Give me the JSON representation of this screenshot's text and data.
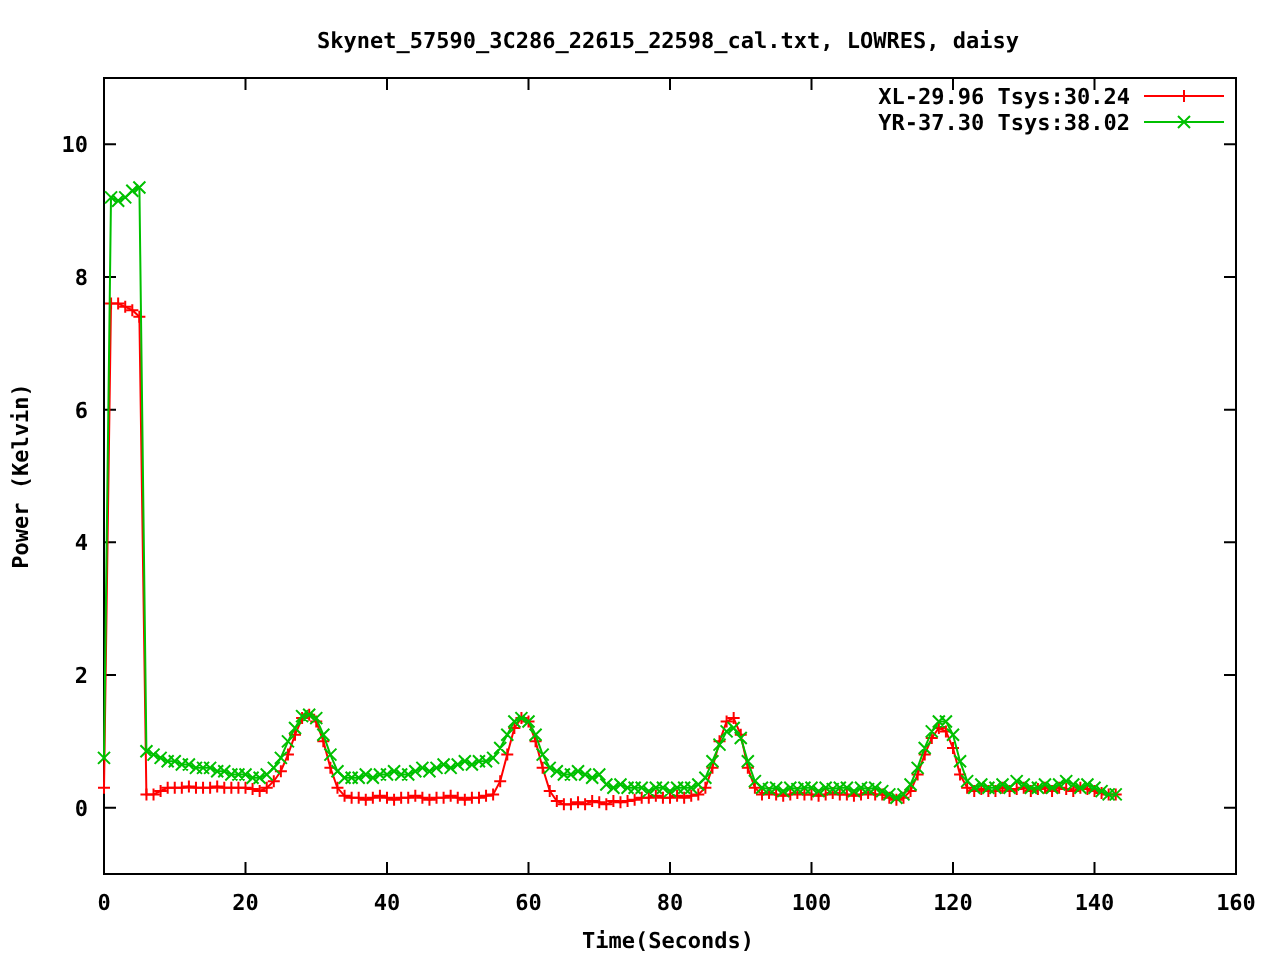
{
  "chart_data": {
    "type": "line",
    "title": "Skynet_57590_3C286_22615_22598_cal.txt, LOWRES, daisy",
    "xlabel": "Time(Seconds)",
    "ylabel": "Power (Kelvin)",
    "xlim": [
      0,
      160
    ],
    "ylim": [
      -1,
      11
    ],
    "xticks": [
      0,
      20,
      40,
      60,
      80,
      100,
      120,
      140,
      160
    ],
    "yticks": [
      0,
      2,
      4,
      6,
      8,
      10
    ],
    "legend": true,
    "x": [
      0,
      1,
      2,
      3,
      4,
      5,
      6,
      7,
      8,
      9,
      10,
      11,
      12,
      13,
      14,
      15,
      16,
      17,
      18,
      19,
      20,
      21,
      22,
      23,
      24,
      25,
      26,
      27,
      28,
      29,
      30,
      31,
      32,
      33,
      34,
      35,
      36,
      37,
      38,
      39,
      40,
      41,
      42,
      43,
      44,
      45,
      46,
      47,
      48,
      49,
      50,
      51,
      52,
      53,
      54,
      55,
      56,
      57,
      58,
      59,
      60,
      61,
      62,
      63,
      64,
      65,
      66,
      67,
      68,
      69,
      70,
      71,
      72,
      73,
      74,
      75,
      76,
      77,
      78,
      79,
      80,
      81,
      82,
      83,
      84,
      85,
      86,
      87,
      88,
      89,
      90,
      91,
      92,
      93,
      94,
      95,
      96,
      97,
      98,
      99,
      100,
      101,
      102,
      103,
      104,
      105,
      106,
      107,
      108,
      109,
      110,
      111,
      112,
      113,
      114,
      115,
      116,
      117,
      118,
      119,
      120,
      121,
      122,
      123,
      124,
      125,
      126,
      127,
      128,
      129,
      130,
      131,
      132,
      133,
      134,
      135,
      136,
      137,
      138,
      139,
      140,
      141,
      142,
      143
    ],
    "series": [
      {
        "name": "XL-29.96 Tsys:30.24",
        "color": "#ff0000",
        "marker": "plus",
        "values": [
          0.3,
          7.6,
          7.6,
          7.55,
          7.5,
          7.4,
          0.2,
          0.2,
          0.25,
          0.3,
          0.3,
          0.3,
          0.32,
          0.3,
          0.3,
          0.3,
          0.32,
          0.3,
          0.3,
          0.3,
          0.3,
          0.28,
          0.25,
          0.3,
          0.4,
          0.55,
          0.8,
          1.1,
          1.35,
          1.4,
          1.3,
          1.0,
          0.6,
          0.3,
          0.18,
          0.15,
          0.15,
          0.12,
          0.15,
          0.18,
          0.15,
          0.12,
          0.15,
          0.15,
          0.18,
          0.15,
          0.12,
          0.15,
          0.15,
          0.18,
          0.15,
          0.12,
          0.15,
          0.15,
          0.18,
          0.2,
          0.4,
          0.8,
          1.2,
          1.35,
          1.3,
          1.0,
          0.6,
          0.25,
          0.1,
          0.05,
          0.05,
          0.08,
          0.05,
          0.1,
          0.08,
          0.05,
          0.1,
          0.08,
          0.1,
          0.12,
          0.15,
          0.15,
          0.18,
          0.15,
          0.15,
          0.18,
          0.15,
          0.18,
          0.2,
          0.3,
          0.6,
          1.0,
          1.3,
          1.35,
          1.1,
          0.6,
          0.3,
          0.2,
          0.22,
          0.2,
          0.18,
          0.2,
          0.22,
          0.2,
          0.2,
          0.18,
          0.2,
          0.22,
          0.2,
          0.2,
          0.18,
          0.2,
          0.22,
          0.2,
          0.2,
          0.15,
          0.12,
          0.15,
          0.25,
          0.5,
          0.8,
          1.05,
          1.2,
          1.15,
          0.9,
          0.5,
          0.3,
          0.25,
          0.28,
          0.25,
          0.25,
          0.3,
          0.25,
          0.28,
          0.3,
          0.25,
          0.28,
          0.3,
          0.25,
          0.3,
          0.28,
          0.25,
          0.3,
          0.28,
          0.25,
          0.22,
          0.2,
          0.2
        ]
      },
      {
        "name": "YR-37.30 Tsys:38.02",
        "color": "#00c000",
        "marker": "cross",
        "values": [
          0.75,
          9.2,
          9.15,
          9.2,
          9.3,
          9.35,
          0.85,
          0.8,
          0.75,
          0.7,
          0.7,
          0.65,
          0.65,
          0.6,
          0.6,
          0.6,
          0.55,
          0.55,
          0.5,
          0.5,
          0.5,
          0.45,
          0.45,
          0.5,
          0.6,
          0.75,
          1.0,
          1.2,
          1.38,
          1.4,
          1.35,
          1.1,
          0.8,
          0.55,
          0.45,
          0.45,
          0.45,
          0.5,
          0.45,
          0.5,
          0.5,
          0.55,
          0.5,
          0.5,
          0.55,
          0.6,
          0.55,
          0.6,
          0.65,
          0.6,
          0.65,
          0.7,
          0.65,
          0.7,
          0.7,
          0.75,
          0.9,
          1.1,
          1.3,
          1.35,
          1.3,
          1.1,
          0.8,
          0.6,
          0.55,
          0.5,
          0.5,
          0.55,
          0.5,
          0.45,
          0.5,
          0.35,
          0.3,
          0.35,
          0.3,
          0.3,
          0.3,
          0.25,
          0.3,
          0.3,
          0.25,
          0.3,
          0.3,
          0.3,
          0.35,
          0.45,
          0.7,
          0.95,
          1.15,
          1.2,
          1.05,
          0.7,
          0.4,
          0.3,
          0.28,
          0.3,
          0.25,
          0.3,
          0.28,
          0.3,
          0.3,
          0.25,
          0.3,
          0.28,
          0.3,
          0.3,
          0.25,
          0.3,
          0.28,
          0.3,
          0.25,
          0.2,
          0.15,
          0.2,
          0.35,
          0.6,
          0.9,
          1.15,
          1.3,
          1.3,
          1.1,
          0.7,
          0.4,
          0.3,
          0.35,
          0.3,
          0.3,
          0.35,
          0.3,
          0.4,
          0.35,
          0.3,
          0.3,
          0.35,
          0.3,
          0.35,
          0.4,
          0.35,
          0.3,
          0.35,
          0.3,
          0.25,
          0.2,
          0.2
        ]
      }
    ]
  }
}
